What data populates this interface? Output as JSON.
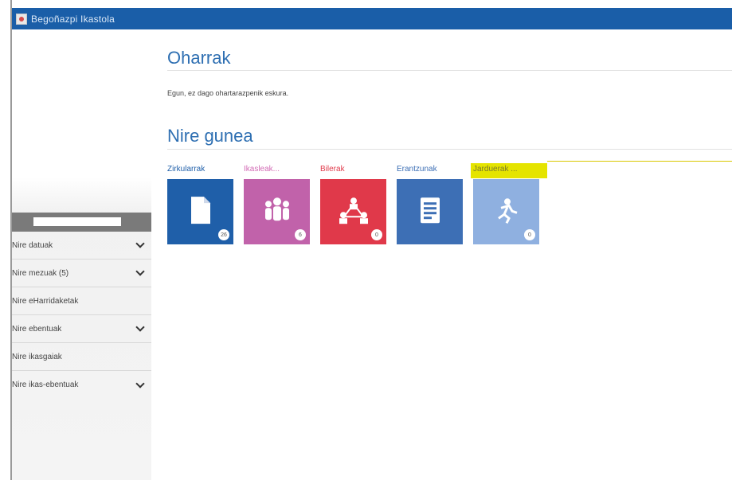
{
  "window": {
    "title": "Begoñazpi Ikastola"
  },
  "sidebar": {
    "items": [
      {
        "label": "Nire datuak",
        "expandable": true
      },
      {
        "label": "Nire mezuak (5)",
        "expandable": true
      },
      {
        "label": "Nire eHarridaketak",
        "expandable": false
      },
      {
        "label": "Nire ebentuak",
        "expandable": true
      },
      {
        "label": "Nire ikasgaiak",
        "expandable": false
      },
      {
        "label": "Nire ikas-ebentuak",
        "expandable": true
      }
    ]
  },
  "oharrak": {
    "title": "Oharrak",
    "text": "Egun, ez dago ohartarazpenik eskura."
  },
  "gunea": {
    "title": "Nire gunea",
    "tiles": [
      {
        "label": "Zirkularrak",
        "color": "#1f5fa9",
        "label_color": "#1f5fa9",
        "icon": "document-icon",
        "badge": "26"
      },
      {
        "label": "Ikasleak...",
        "color": "#c162aa",
        "label_color": "#d26bb5",
        "icon": "people-icon",
        "badge": "6"
      },
      {
        "label": "Bilerak",
        "color": "#e0394a",
        "label_color": "#e0394a",
        "icon": "network-icon",
        "badge": "0"
      },
      {
        "label": "Erantzunak",
        "color": "#3d6fb5",
        "label_color": "#3d6fb5",
        "icon": "list-document-icon",
        "badge": ""
      },
      {
        "label": "Jarduerak ...",
        "color": "#8fb0e0",
        "label_color": "#7a7a2a",
        "icon": "person-running-icon",
        "badge": "0"
      }
    ]
  },
  "colors": {
    "titlebar": "#1a5ea8",
    "section_title": "#2e6fb2",
    "highlight": "#e5e400"
  }
}
